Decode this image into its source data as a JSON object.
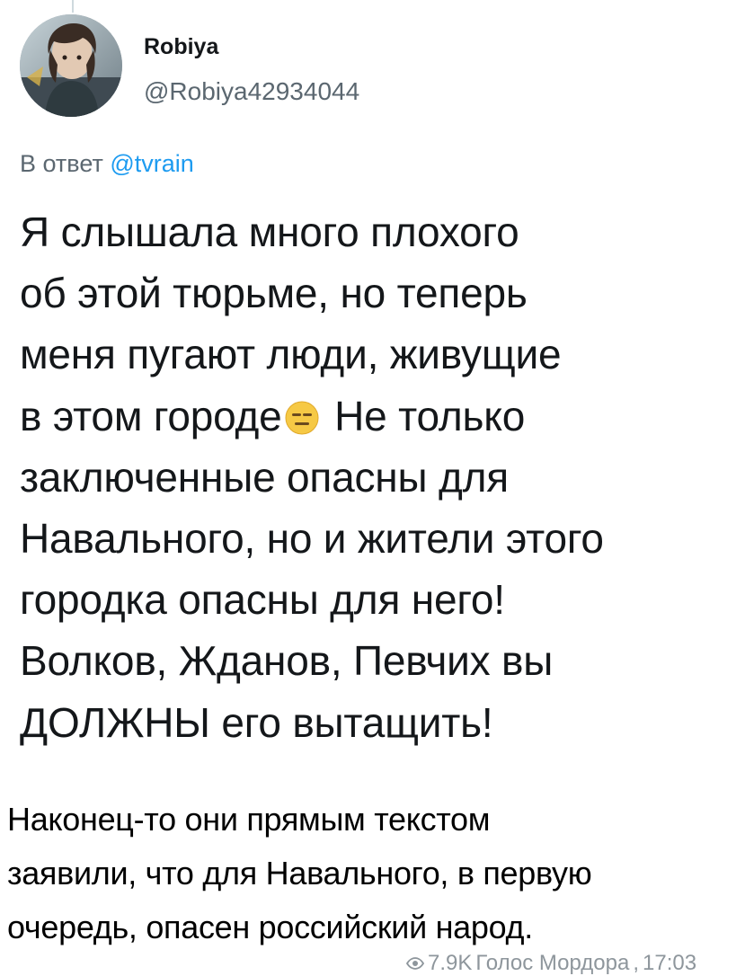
{
  "tweet": {
    "author_name": "Robiya",
    "author_handle": "@Robiya42934044",
    "reply_prefix": "В ответ",
    "reply_mention": "@tvrain",
    "text_part1": "Я слышала много плохого\nоб этой тюрьме, но теперь\nменя пугают люди, живущие\nв этом городе",
    "emoji": "expressionless-face-icon",
    "text_part2": " Не только\nзаключенные опасны для\nНавального, но и жители этого\nгородка опасны для него!\nВолков, Жданов, Певчих вы\nДОЛЖНЫ его вытащить!"
  },
  "caption": {
    "text": "Наконец-то они прямым текстом\nзаявили, что для Навального, в первую\nочередь, опасен российский народ."
  },
  "footer": {
    "views": "7.9K",
    "channel": "Голос Мордора",
    "time": "17:03"
  },
  "colors": {
    "text": "#14171a",
    "secondary": "#5b6770",
    "link": "#1d9bf0",
    "footer": "#8e969c"
  }
}
